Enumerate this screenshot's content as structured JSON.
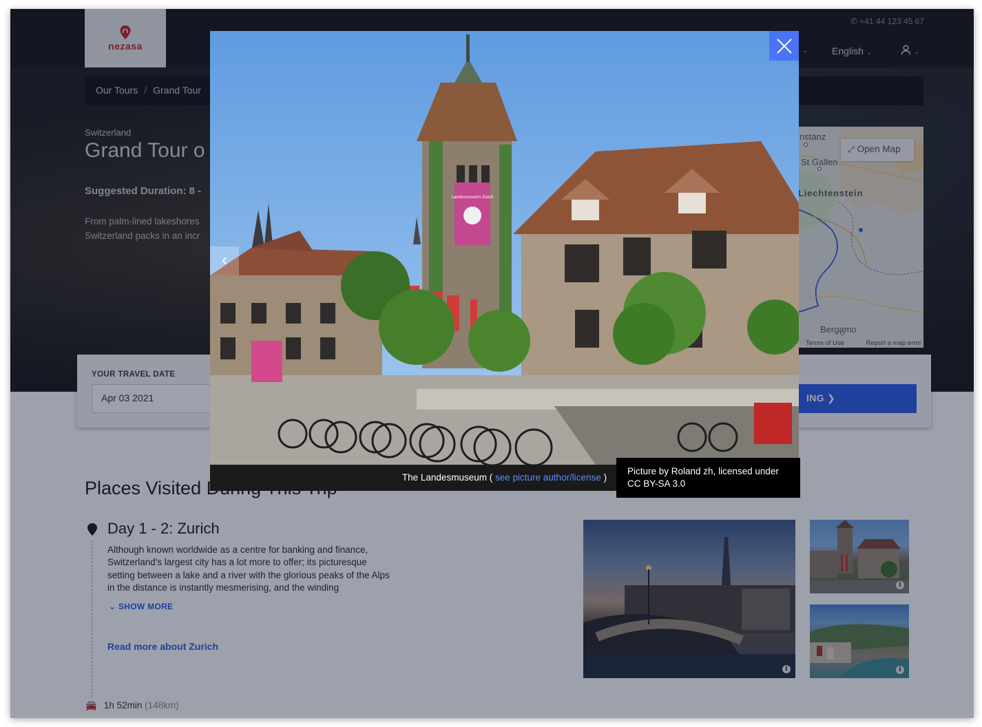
{
  "header": {
    "brand": "nezasa",
    "phone": "+41 44 123 45 67",
    "language": "English"
  },
  "breadcrumb": {
    "items": [
      "Our Tours",
      "Grand Tour"
    ]
  },
  "tour": {
    "country": "Switzerland",
    "title_visible": "Grand Tour o",
    "duration_visible": "Suggested Duration: 8 -",
    "intro_line1": "From palm-lined lakeshores",
    "intro_line2": "Switzerland packs in an incr"
  },
  "map": {
    "open_label": "Open Map",
    "labels": [
      "nstanz",
      "St Gallen",
      "Liechtenstein",
      "Bergamo"
    ],
    "footer_terms": "Terms of Use",
    "footer_report": "Report a map error"
  },
  "booking": {
    "date_label": "YOUR TRAVEL DATE",
    "date_value": "Apr 03 2021",
    "button_visible": "ING"
  },
  "places": {
    "title_visible": "Places Visited During This Trip",
    "day_title": "Day 1 - 2: Zurich",
    "day_description": "Although known worldwide as a centre for banking and finance, Switzerland's largest city has a lot more to offer; its picturesque setting between a lake and a river with the glorious peaks of the Alps in the distance is instantly mesmerising, and the winding",
    "show_more": "SHOW MORE",
    "read_more": "Read more about Zurich",
    "drive_time": "1h 52min",
    "drive_distance": "(148km)"
  },
  "lightbox": {
    "caption_text": "The Landesmuseum (",
    "caption_link": "see picture author/license",
    "caption_close": ")",
    "tooltip": "Picture by Roland zh, licensed under CC BY-SA 3.0",
    "banner_text": "Landesmuseum Zurich"
  },
  "icons": {
    "close": "close-icon",
    "prev": "chevron-left-icon",
    "info": "info-icon"
  },
  "colors": {
    "accent": "#2f5ee8",
    "close_button": "#4a74f5",
    "brand": "#c9252c"
  }
}
